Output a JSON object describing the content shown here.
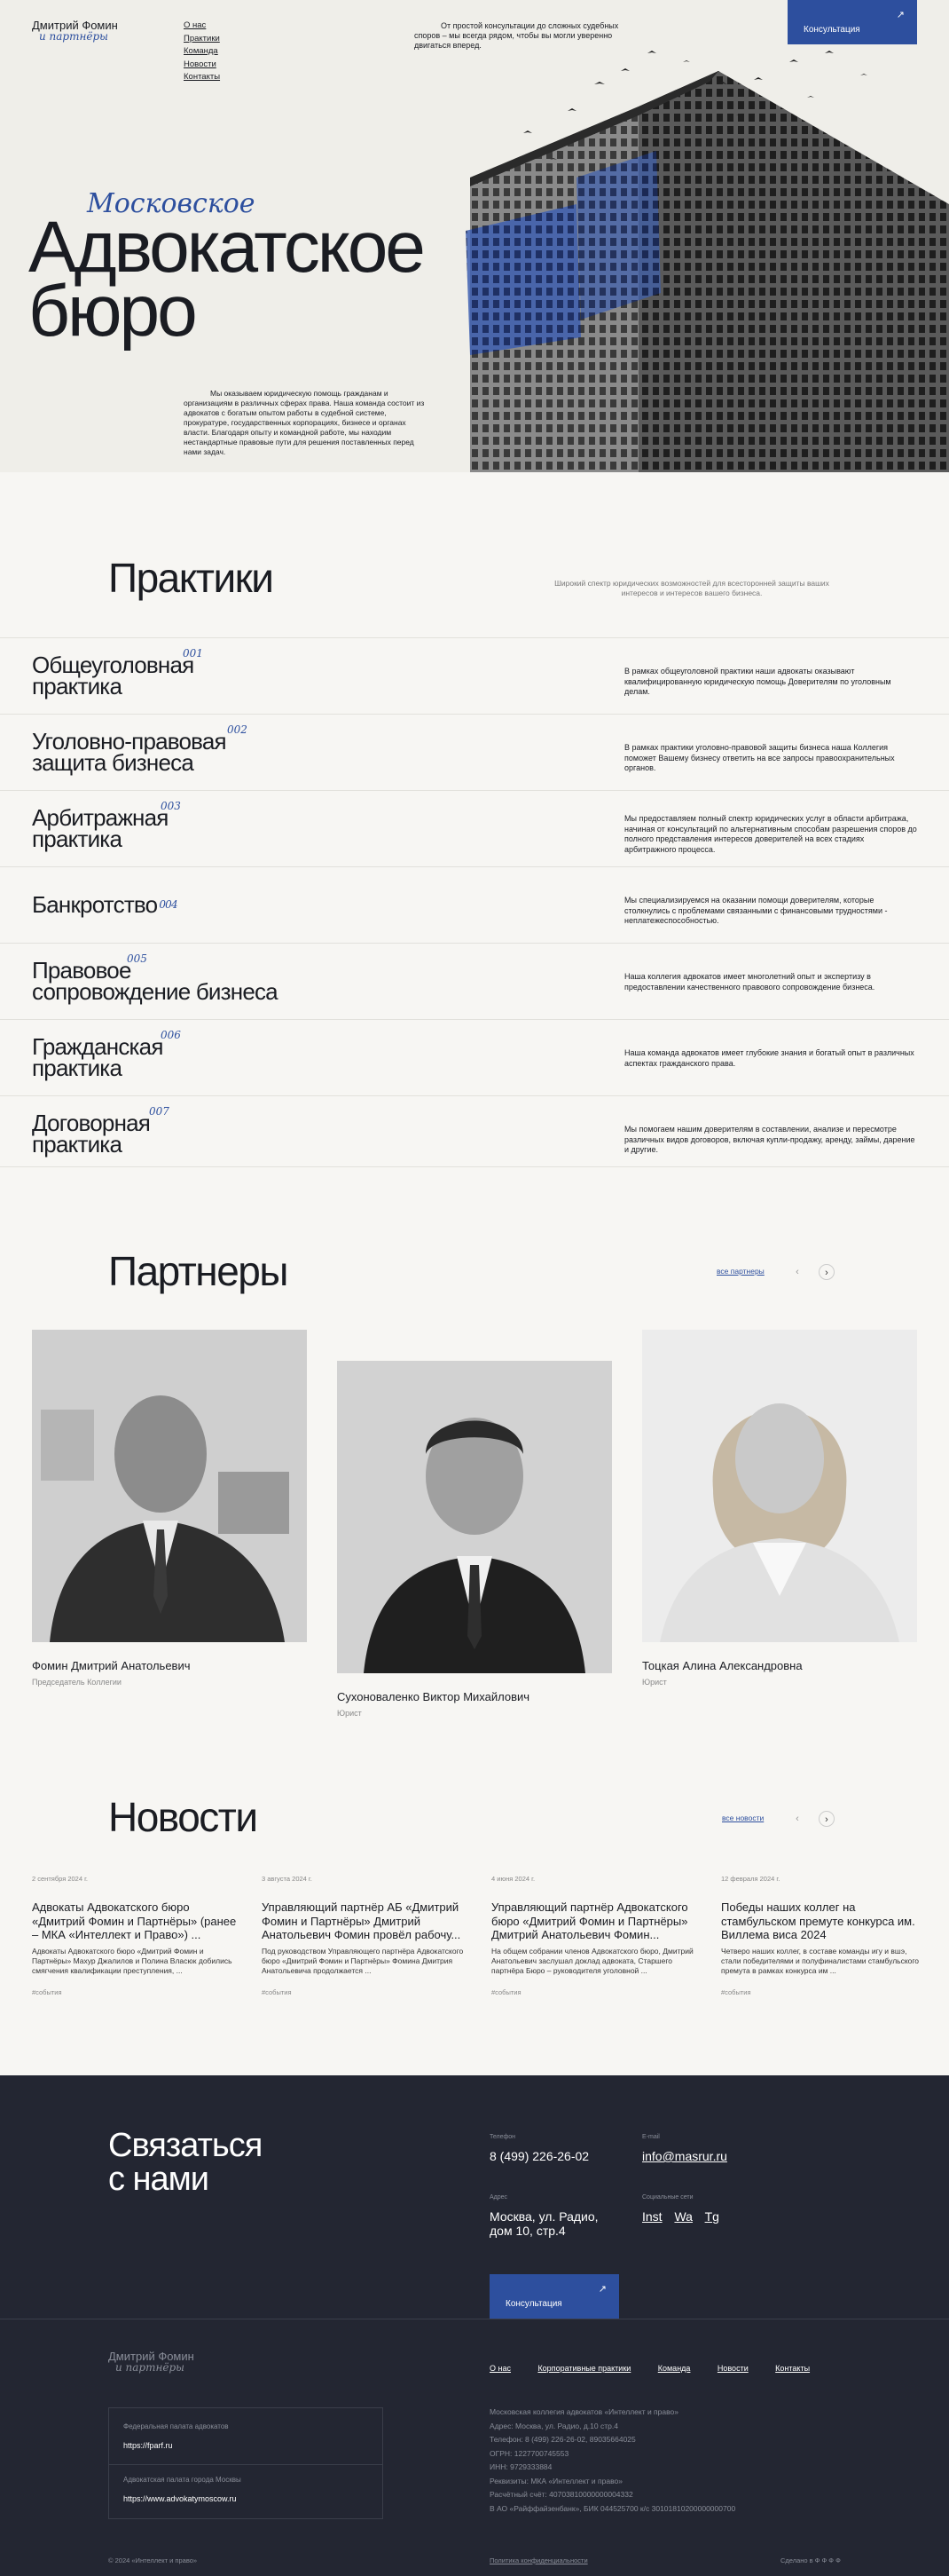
{
  "header": {
    "logo_line1": "Дмитрий Фомин",
    "logo_line2": "и партнёры",
    "nav": [
      "О нас",
      "Практики",
      "Команда",
      "Новости",
      "Контакты"
    ],
    "quote": "От простой консультации до сложных судебных споров – мы всегда рядом, чтобы вы могли уверенно двигаться вперед.",
    "cta": "Консультация"
  },
  "hero": {
    "script": "Московское",
    "title_line1": "Адвокатское",
    "title_line2": "бюро",
    "desc": "Мы оказываем юридическую помощь гражданам и организациям в различных сферах права. Наша команда состоит из адвокатов с богатым опытом работы в судебной системе, прокуратуре, государственных корпорациях, бизнесе и органах власти. Благодаря опыту и командной работе, мы находим нестандартные правовые пути для решения поставленных перед нами задач."
  },
  "practices": {
    "title": "Практики",
    "subtitle": "Широкий спектр юридических возможностей для всесторонней защиты ваших интересов и интересов вашего бизнеса.",
    "items": [
      {
        "l1": "Общеуголовная",
        "l2": "практика",
        "num": "001",
        "desc": "В рамках общеуголовной практики наши адвокаты оказывают квалифицированную юридическую помощь Доверителям по уголовным делам."
      },
      {
        "l1": "Уголовно-правовая",
        "l2": "защита бизнеса",
        "num": "002",
        "desc": "В рамках практики уголовно-правовой защиты бизнеса наша Коллегия поможет Вашему бизнесу ответить на все запросы правоохранительных органов."
      },
      {
        "l1": "Арбитражная",
        "l2": "практика",
        "num": "003",
        "desc": "Мы предоставляем полный спектр юридических услуг в области арбитража, начиная от консультаций по альтернативным способам разрешения споров до полного представления интересов доверителей на всех стадиях арбитражного процесса."
      },
      {
        "l1": "Банкротство",
        "l2": "",
        "num": "004",
        "desc": "Мы специализируемся на оказании помощи доверителям, которые столкнулись с проблемами связанными с финансовыми трудностями - неплатежеспособностью."
      },
      {
        "l1": "Правовое",
        "l2": "сопровождение бизнеса",
        "num": "005",
        "desc": "Наша коллегия адвокатов имеет многолетний опыт и экспертизу в предоставлении качественного правового сопровождение бизнеса."
      },
      {
        "l1": "Гражданская",
        "l2": "практика",
        "num": "006",
        "desc": "Наша команда адвокатов имеет глубокие знания и богатый опыт в различных аспектах гражданского права."
      },
      {
        "l1": "Договорная",
        "l2": "практика",
        "num": "007",
        "desc": "Мы помогаем нашим доверителям в составлении, анализе и пересмотре различных видов договоров, включая купли-продажу, аренду, займы, дарение и другие."
      }
    ]
  },
  "partners": {
    "title": "Партнеры",
    "all": "все партнеры",
    "prev": "‹",
    "next": "›",
    "items": [
      {
        "name": "Фомин Дмитрий Анатольевич",
        "role": "Председатель Коллегии"
      },
      {
        "name": "Сухоноваленко Виктор Михайлович",
        "role": "Юрист"
      },
      {
        "name": "Тоцкая Алина Александровна",
        "role": "Юрист"
      }
    ]
  },
  "news": {
    "title": "Новости",
    "all": "все новости",
    "prev": "‹",
    "next": "›",
    "items": [
      {
        "date": "2 сентября 2024 г.",
        "title": "Адвокаты Адвокатского бюро «Дмитрий Фомин и Партнёры» (ранее – МКА «Интеллект и Право») ...",
        "text": "Адвокаты Адвокатского бюро «Дмитрий Фомин и Партнёры» Махур Джалилов и Полина Власюк добились смягчения квалификации преступления, ...",
        "tag": "#события"
      },
      {
        "date": "3 августа 2024 г.",
        "title": "Управляющий партнёр АБ «Дмитрий Фомин и Партнёры» Дмитрий Анатольевич Фомин провёл рабочу...",
        "text": "Под руководством Управляющего партнёра Адвокатского бюро «Дмитрий Фомин и Партнёры» Фомина Дмитрия Анатольевича продолжается ...",
        "tag": "#события"
      },
      {
        "date": "4 июня 2024 г.",
        "title": "Управляющий партнёр Адвокатского бюро «Дмитрий Фомин и Партнёры» Дмитрий Анатольевич Фомин...",
        "text": "На общем собрании членов Адвокатского бюро, Дмитрий Анатольевич заслушал доклад адвоката, Старшего партнёра Бюро – руководителя уголовной ...",
        "tag": "#события"
      },
      {
        "date": "12 февраля 2024 г.",
        "title": "Победы наших коллег на стамбульском премуте конкурса им. Виллема виса 2024",
        "text": "Четверо наших коллег, в составе команды игу и вшэ, стали победителями и полуфиналистами стамбульского премута в рамках конкурса им ...",
        "tag": "#события"
      }
    ]
  },
  "contact": {
    "title_l1": "Связаться",
    "title_l2": "с нами",
    "phone_label": "Телефон",
    "phone": "8 (499) 226-26-02",
    "email_label": "E-mail",
    "email": "info@masrur.ru",
    "addr_label": "Адрес",
    "addr_l1": "Москва, ул. Радио,",
    "addr_l2": "дом 10, стр.4",
    "social_label": "Социальные сети",
    "social": [
      "Inst",
      "Wa",
      "Tg"
    ],
    "cta": "Консультация"
  },
  "footer": {
    "logo_line1": "Дмитрий Фомин",
    "logo_line2": "и партнёры",
    "links": [
      "О нас",
      "Корпоративные практики",
      "Команда",
      "Новости",
      "Контакты"
    ],
    "box": [
      {
        "label": "Федеральная палата адвокатов",
        "url": "https://fparf.ru"
      },
      {
        "label": "Адвокатская палата города Москвы",
        "url": "https://www.advokatymoscow.ru"
      }
    ],
    "info": [
      "Московская коллегия адвокатов «Интеллект и право»",
      "Адрес: Москва, ул. Радио, д.10 стр.4",
      "Телефон: 8 (499) 226-26-02, 89035664025",
      "ОГРН: 1227700745553",
      "ИНН: 9729333884",
      "Реквизиты: МКА «Интеллект и право»",
      "Расчётный счёт: 40703810000000004332",
      "В АО «Райффайзенбанк», БИК 044525700 к/с 30101810200000000700"
    ],
    "copyright": "© 2024 «Интеллект и право»",
    "policy": "Политика конфиденциальности",
    "credit": "Сделано в Ф Ф Ф Ф"
  }
}
